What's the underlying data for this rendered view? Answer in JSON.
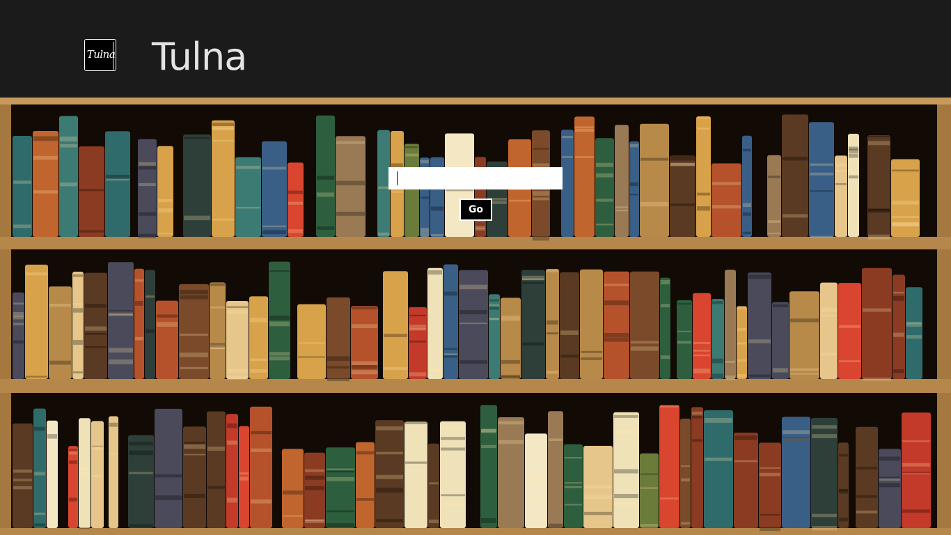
{
  "app": {
    "title": "Tulna",
    "logo_text": "Tulna"
  },
  "search": {
    "value": "",
    "placeholder": ""
  },
  "actions": {
    "go_label": "Go"
  },
  "colors": {
    "header_background": "#1b1b1b",
    "title_text": "#e4e4e4",
    "shelf_wood": "#a5783f",
    "shelf_shadow": "#120a05",
    "input_background": "#ffffff",
    "button_background": "#000000",
    "button_border": "#ffffff"
  },
  "background_image": "bookshelf-painting"
}
